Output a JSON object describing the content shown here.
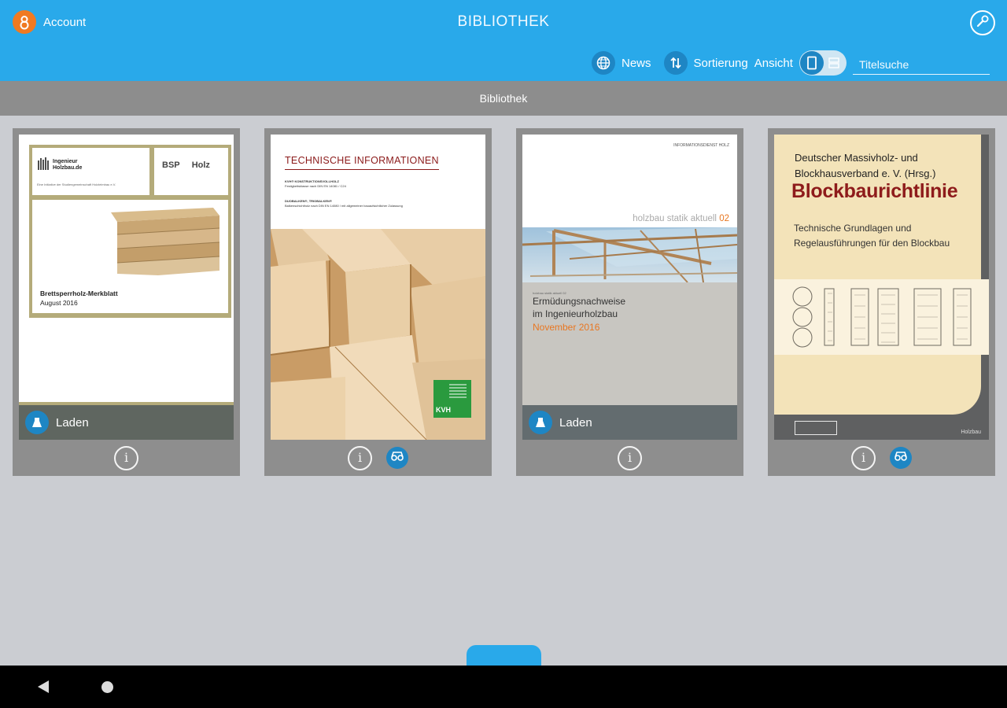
{
  "header": {
    "account_label": "Account",
    "app_title": "BIBLIOTHEK",
    "toolbar": {
      "news_label": "News",
      "sort_label": "Sortierung",
      "view_label": "Ansicht",
      "search_placeholder": "Titelsuche"
    }
  },
  "subheader": {
    "title": "Bibliothek"
  },
  "books": [
    {
      "cover_brand": "Ingenieur\nHolzbau.de",
      "cover_small": "Eine Initiative der Studiengemeinschaft Holzleimbau e.V.",
      "cover_logo": "BSP     Holz",
      "cover_title": "Brettsperrholz-Merkblatt",
      "cover_subtitle": "August 2016",
      "load_label": "Laden"
    },
    {
      "cover_title": "TECHNISCHE INFORMATIONEN",
      "cover_line1": "KVH® KONSTRUKTIONSVOLLHOLZ",
      "cover_line1b": "Festigkeitsklasse nach DIN EN 14081 / C24",
      "cover_line2": "DUOBALKEN®, TRIOBALKEN®",
      "cover_line2b": "Balkenschichtholz nach DIN EN 14080 / mit allgemeiner bauaufsichtlicher Zulassung",
      "cover_logo": "KVH"
    },
    {
      "cover_header": "INFORMATIONSDIENST HOLZ",
      "cover_series": "holzbau statik aktuell",
      "cover_series_no": "02",
      "cover_small": "holzbau statik aktuell 02",
      "cover_title": "Ermüdungsnachweise\nim Ingenieurholzbau",
      "cover_date": "November 2016",
      "load_label": "Laden"
    },
    {
      "cover_publisher": "Deutscher Massivholz- und\nBlockhausverband e. V. (Hrsg.)",
      "cover_title": "Blockbaurichtlinie",
      "cover_subtitle": "Technische Grundlagen und\nRegelausführungen für den Blockbau",
      "cover_footer": "Holzbau"
    }
  ],
  "colors": {
    "accent": "#29a9ea",
    "accent_dark": "#1e86c4",
    "account": "#f07a22",
    "subheader": "#8d8d8d",
    "background": "#cbcdd2"
  },
  "icons": {
    "account": "person-icon",
    "settings": "wrench-icon",
    "news": "globe-icon",
    "sort": "sort-arrows-icon",
    "view": "view-toggle-icon",
    "info": "info-icon",
    "reader": "reader-icon",
    "load": "download-icon"
  }
}
